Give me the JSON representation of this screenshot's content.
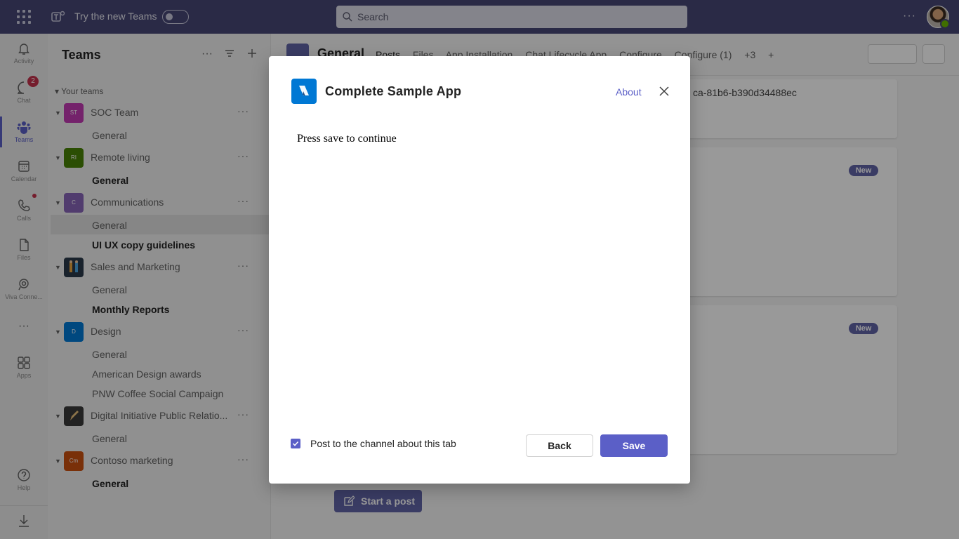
{
  "topbar": {
    "try_new_teams": "Try the new Teams",
    "search_placeholder": "Search",
    "more": "···"
  },
  "rail": {
    "items": [
      {
        "label": "Activity",
        "icon": "bell-icon"
      },
      {
        "label": "Chat",
        "icon": "chat-icon",
        "badge": "2"
      },
      {
        "label": "Teams",
        "icon": "teams-icon",
        "active": true
      },
      {
        "label": "Calendar",
        "icon": "calendar-icon"
      },
      {
        "label": "Calls",
        "icon": "phone-icon"
      },
      {
        "label": "Files",
        "icon": "file-icon"
      },
      {
        "label": "Viva Conne...",
        "icon": "viva-connections-icon"
      },
      {
        "label": "···",
        "icon": "more-icon"
      },
      {
        "label": "Apps",
        "icon": "apps-icon"
      },
      {
        "label": "Help",
        "icon": "help-icon"
      },
      {
        "label": "",
        "icon": "download-icon"
      }
    ]
  },
  "teams_panel": {
    "title": "Teams",
    "section_label": "Your teams",
    "teams": [
      {
        "name": "SOC Team",
        "initials": "ST",
        "color": "#c239b3",
        "channels": [
          {
            "name": "General",
            "bold": false
          }
        ]
      },
      {
        "name": "Remote living",
        "initials": "RI",
        "color": "#498205",
        "channels": [
          {
            "name": "General",
            "bold": true
          }
        ]
      },
      {
        "name": "Communications",
        "initials": "C",
        "color": "#8764b8",
        "channels": [
          {
            "name": "General",
            "bold": false
          },
          {
            "name": "UI UX copy guidelines",
            "bold": true
          }
        ]
      },
      {
        "name": "Sales and Marketing",
        "initials": "",
        "color": "#2b3a4a",
        "channels": [
          {
            "name": "General",
            "bold": false
          },
          {
            "name": "Monthly Reports",
            "bold": true
          }
        ]
      },
      {
        "name": "Design",
        "initials": "D",
        "color": "#0078d4",
        "channels": [
          {
            "name": "General",
            "bold": false
          },
          {
            "name": "American Design awards",
            "bold": false
          },
          {
            "name": "PNW Coffee Social Campaign",
            "bold": false
          }
        ]
      },
      {
        "name": "Digital Initiative Public Relatio...",
        "initials": "",
        "color": "#3a3a3a",
        "channels": [
          {
            "name": "General",
            "bold": false
          }
        ]
      },
      {
        "name": "Contoso marketing",
        "initials": "Cm",
        "color": "#ca5010",
        "channels": [
          {
            "name": "General",
            "bold": true
          }
        ]
      }
    ]
  },
  "channel_header": {
    "title": "General",
    "tabs": [
      "Posts",
      "Files",
      "App Installation",
      "Chat Lifecycle App",
      "Configure",
      "Configure (1)",
      "+3"
    ]
  },
  "content": {
    "card_id_text": "ca-81b6-b390d34488ec",
    "new_badge": "New",
    "start_post": "Start a post"
  },
  "dialog": {
    "app_name": "Complete Sample App",
    "about": "About",
    "body_text": "Press save to continue",
    "checkbox_label": "Post to the channel about this tab",
    "checkbox_checked": true,
    "back_label": "Back",
    "save_label": "Save",
    "accent_color": "#5b5fc7"
  }
}
